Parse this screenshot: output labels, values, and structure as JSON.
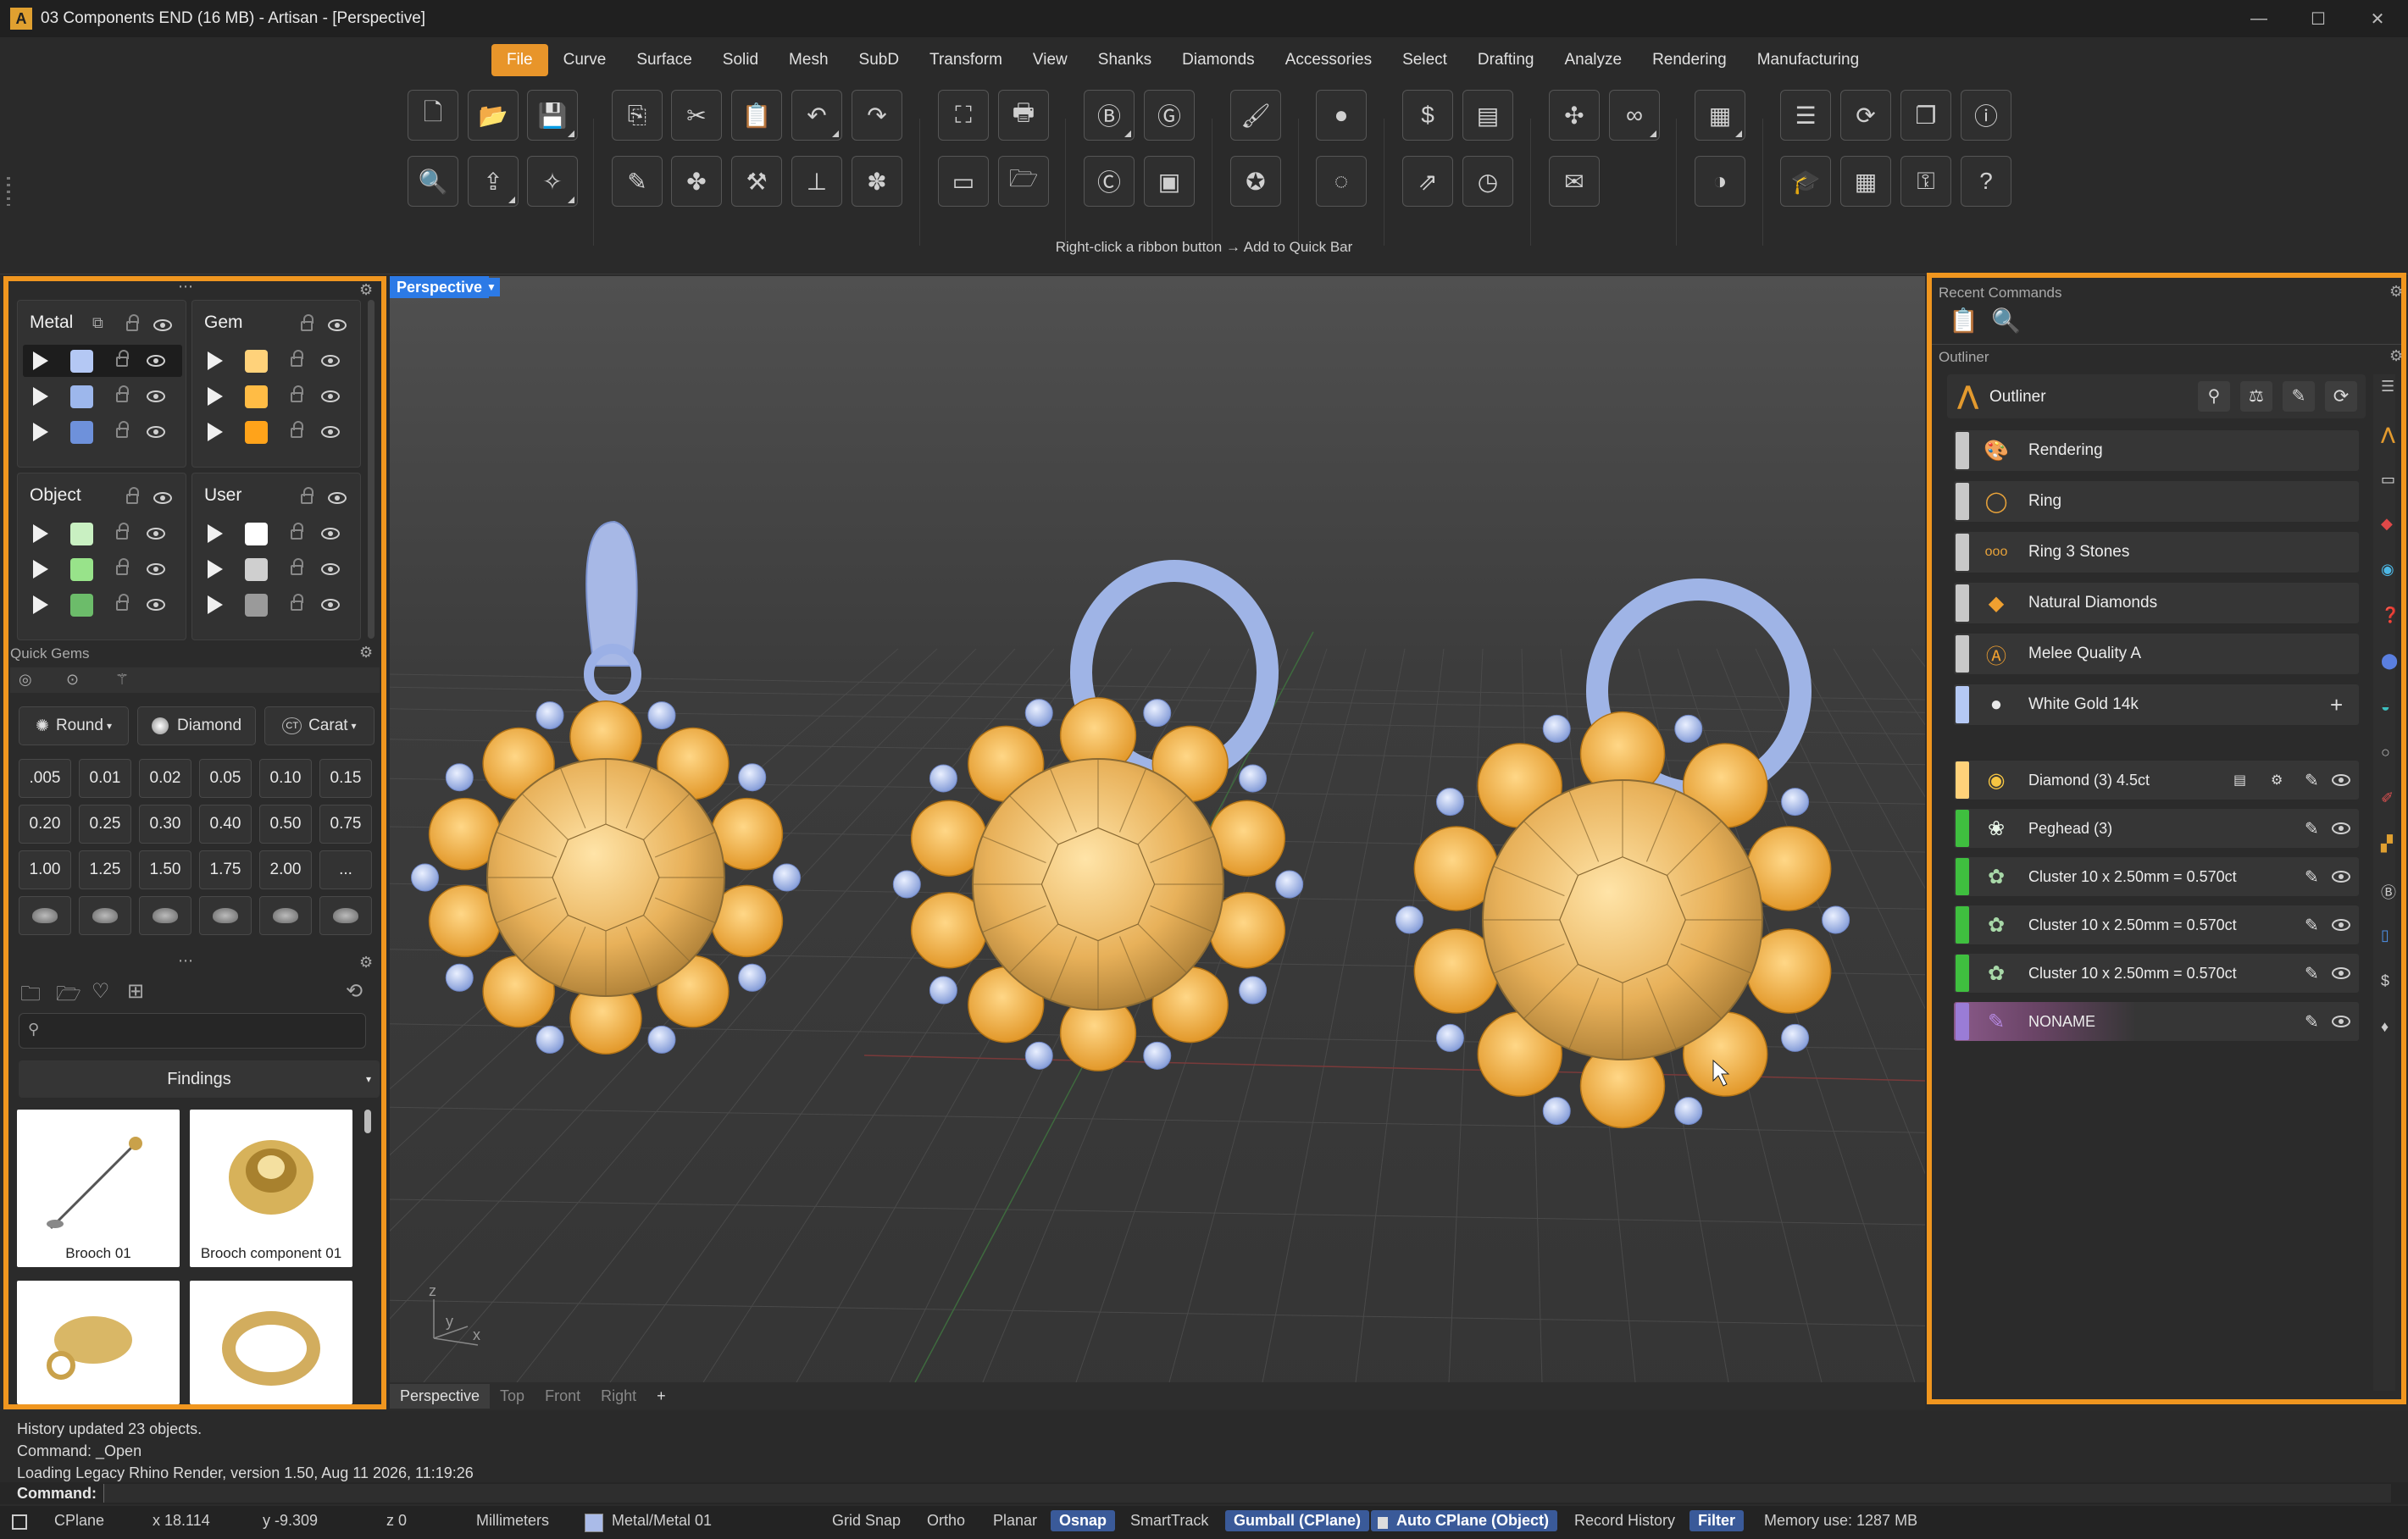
{
  "window": {
    "title": "03 Components END (16 MB) - Artisan - [Perspective]",
    "logo": "A",
    "minimize": "—",
    "maximize": "☐",
    "close": "✕"
  },
  "menu": {
    "tabs": [
      "File",
      "Curve",
      "Surface",
      "Solid",
      "Mesh",
      "SubD",
      "Transform",
      "View",
      "Shanks",
      "Diamonds",
      "Accessories",
      "Select",
      "Drafting",
      "Analyze",
      "Rendering",
      "Manufacturing"
    ],
    "active": "File"
  },
  "ribbon": {
    "hint": "Right-click a ribbon button → Add to Quick Bar"
  },
  "layers": {
    "metal": {
      "title": "Metal",
      "colors": [
        "#b4c8f4",
        "#9db7ec",
        "#6e91db"
      ]
    },
    "gem": {
      "title": "Gem",
      "colors": [
        "#ffd27a",
        "#ffbc45",
        "#ffa31a"
      ]
    },
    "object": {
      "title": "Object",
      "colors": [
        "#c9f0c2",
        "#98e38a",
        "#6cbc6a"
      ]
    },
    "user": {
      "title": "User",
      "colors": [
        "#ffffff",
        "#cfcfcf",
        "#9a9a9a"
      ]
    }
  },
  "quick_gems": {
    "label": "Quick Gems",
    "shape": "Round",
    "material": "Diamond",
    "unit": "Carat",
    "unit_icon": "CT",
    "sizes": [
      ".005",
      "0.01",
      "0.02",
      "0.05",
      "0.10",
      "0.15",
      "0.20",
      "0.25",
      "0.30",
      "0.40",
      "0.50",
      "0.75",
      "1.00",
      "1.25",
      "1.50",
      "1.75",
      "2.00",
      "..."
    ]
  },
  "library": {
    "search_placeholder": "",
    "category": "Findings",
    "items": [
      {
        "label": "Brooch 01"
      },
      {
        "label": "Brooch component 01"
      },
      {
        "label": ""
      },
      {
        "label": ""
      }
    ]
  },
  "viewport": {
    "active": "Perspective",
    "tabs": [
      "Perspective",
      "Top",
      "Front",
      "Right"
    ],
    "add": "+",
    "axis_x": "x",
    "axis_y": "y",
    "axis_z": "z"
  },
  "right": {
    "recent_label": "Recent Commands",
    "outliner_label": "Outliner",
    "outliner_title": "Outliner",
    "categories": [
      {
        "label": "Rendering",
        "icon": "palette-icon",
        "strip": "#c8c8c8"
      },
      {
        "label": "Ring",
        "icon": "ring-icon",
        "strip": "#c8c8c8"
      },
      {
        "label": "Ring 3 Stones",
        "icon": "three-stones-icon",
        "strip": "#c8c8c8"
      },
      {
        "label": "Natural Diamonds",
        "icon": "diamond-icon",
        "strip": "#c8c8c8"
      },
      {
        "label": "Melee Quality A",
        "icon": "gem-a-icon",
        "strip": "#c8c8c8"
      },
      {
        "label": "White Gold 14k",
        "icon": "white-gold-icon",
        "strip": "#b4c8f4"
      }
    ],
    "objects": [
      {
        "label": "Diamond (3) 4.5ct",
        "strip": "#ffd27a"
      },
      {
        "label": "Peghead (3)",
        "strip": "#3fbf3f"
      },
      {
        "label": "Cluster 10 x 2.50mm = 0.570ct",
        "strip": "#3fbf3f"
      },
      {
        "label": "Cluster 10 x 2.50mm = 0.570ct",
        "strip": "#3fbf3f"
      },
      {
        "label": "Cluster 10 x 2.50mm = 0.570ct",
        "strip": "#3fbf3f"
      },
      {
        "label": "NONAME",
        "strip": "#9a7cd6"
      }
    ]
  },
  "command": {
    "history": [
      "History updated 23 objects.",
      "Command: _Open",
      "Loading Legacy Rhino Render, version 1.50, Aug 11 2026, 11:19:26"
    ],
    "prompt": "Command:"
  },
  "status": {
    "cplane": "CPlane",
    "x": "x 18.114",
    "y": "y -9.309",
    "z": "z 0",
    "units": "Millimeters",
    "layer": "Metal/Metal 01",
    "grid_snap": "Grid Snap",
    "ortho": "Ortho",
    "planar": "Planar",
    "osnap": "Osnap",
    "smarttrack": "SmartTrack",
    "gumball": "Gumball (CPlane)",
    "auto_cplane": "Auto CPlane (Object)",
    "record_history": "Record History",
    "filter": "Filter",
    "memory": "Memory use: 1287 MB"
  },
  "colors": {
    "accent": "#f0961f",
    "gem": "#f7b33a",
    "metal": "#9fb4e6",
    "viewport_tab": "#2c7ae6"
  }
}
